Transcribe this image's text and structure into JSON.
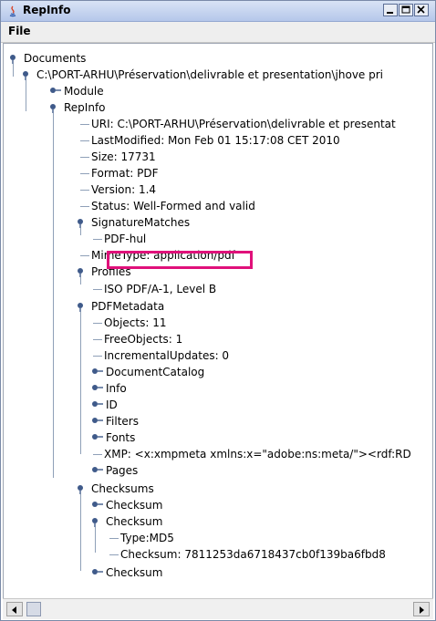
{
  "window": {
    "title": "RepInfo"
  },
  "menu": {
    "file": "File"
  },
  "tree": {
    "nodes": [
      {
        "label": "Documents",
        "name": "tree-node-documents"
      },
      {
        "label": "C:\\PORT-ARHU\\Préservation\\delivrable et presentation\\jhove pri",
        "name": "tree-node-path"
      },
      {
        "label": "Module",
        "name": "tree-node-module"
      },
      {
        "label": "RepInfo",
        "name": "tree-node-repinfo"
      },
      {
        "label": "URI: C:\\PORT-ARHU\\Préservation\\delivrable et presentat",
        "name": "tree-leaf-uri"
      },
      {
        "label": "LastModified: Mon Feb 01 15:17:08 CET 2010",
        "name": "tree-leaf-lastmodified"
      },
      {
        "label": "Size: 17731",
        "name": "tree-leaf-size"
      },
      {
        "label": "Format: PDF",
        "name": "tree-leaf-format"
      },
      {
        "label": "Version: 1.4",
        "name": "tree-leaf-version"
      },
      {
        "label": "Status: Well-Formed and valid",
        "name": "tree-leaf-status"
      },
      {
        "label": "SignatureMatches",
        "name": "tree-node-signaturematches"
      },
      {
        "label": "PDF-hul",
        "name": "tree-leaf-pdf-hul"
      },
      {
        "label": "MimeType: application/pdf",
        "name": "tree-leaf-mimetype"
      },
      {
        "label": "Profiles",
        "name": "tree-node-profiles"
      },
      {
        "label": "ISO PDF/A-1, Level B",
        "name": "tree-leaf-profile"
      },
      {
        "label": "PDFMetadata",
        "name": "tree-node-pdfmetadata"
      },
      {
        "label": "Objects: 11",
        "name": "tree-leaf-objects"
      },
      {
        "label": "FreeObjects: 1",
        "name": "tree-leaf-freeobjects"
      },
      {
        "label": "IncrementalUpdates: 0",
        "name": "tree-leaf-incrementalupdates"
      },
      {
        "label": "DocumentCatalog",
        "name": "tree-node-documentcatalog"
      },
      {
        "label": "Info",
        "name": "tree-node-info"
      },
      {
        "label": "ID",
        "name": "tree-node-id"
      },
      {
        "label": "Filters",
        "name": "tree-node-filters"
      },
      {
        "label": "Fonts",
        "name": "tree-node-fonts"
      },
      {
        "label": "XMP: <x:xmpmeta xmlns:x=\"adobe:ns:meta/\"><rdf:RD",
        "name": "tree-leaf-xmp"
      },
      {
        "label": "Pages",
        "name": "tree-node-pages"
      },
      {
        "label": "Checksums",
        "name": "tree-node-checksums"
      },
      {
        "label": "Checksum",
        "name": "tree-node-checksum-1"
      },
      {
        "label": "Checksum",
        "name": "tree-node-checksum-2"
      },
      {
        "label": "Type:MD5",
        "name": "tree-leaf-type-md5"
      },
      {
        "label": "Checksum: 7811253da6718437cb0f139ba6fbd8",
        "name": "tree-leaf-checksum-value"
      },
      {
        "label": "Checksum",
        "name": "tree-node-checksum-3"
      }
    ]
  },
  "colors": {
    "highlight": "#e0117a",
    "tree_line": "#8fa0b8",
    "titlebar": "#c6d4ef"
  }
}
